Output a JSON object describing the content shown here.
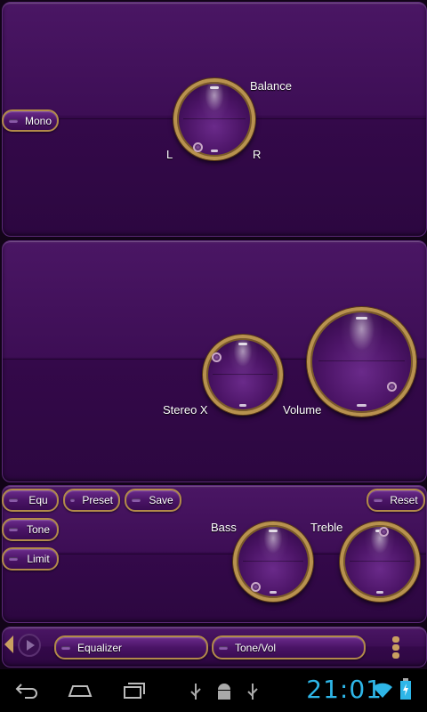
{
  "balance_panel": {
    "mono_label": "Mono",
    "balance_label": "Balance",
    "left_label": "L",
    "right_label": "R"
  },
  "stereo_panel": {
    "stereo_label": "Stereo X",
    "volume_label": "Volume"
  },
  "eq_panel": {
    "equ_label": "Equ",
    "tone_label": "Tone",
    "limit_label": "Limit",
    "preset_label": "Preset",
    "save_label": "Save",
    "reset_label": "Reset",
    "bass_label": "Bass",
    "treble_label": "Treble"
  },
  "tab_bar": {
    "tab1": "Equalizer",
    "tab2": "Tone/Vol"
  },
  "status_bar": {
    "clock": "21:01"
  },
  "colors": {
    "panel": "#3d0e55",
    "gold": "#b8924e",
    "clock": "#2eb6e8"
  }
}
